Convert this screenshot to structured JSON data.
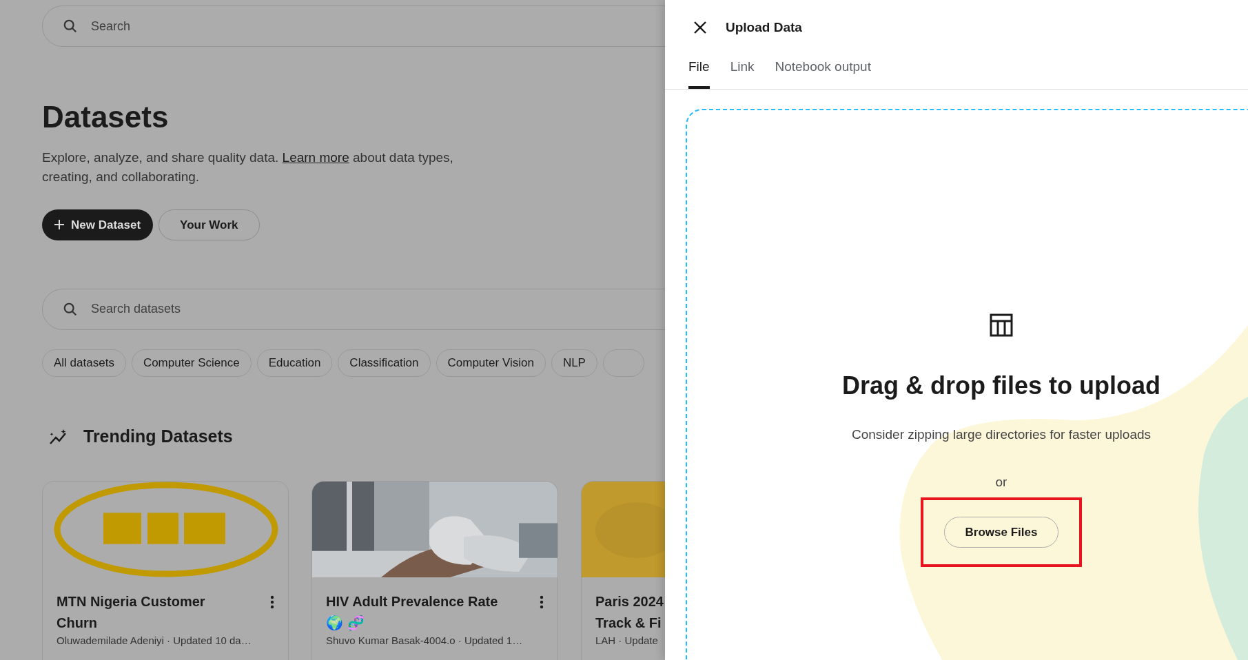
{
  "page": {
    "search": {
      "placeholder": "Search"
    },
    "title": "Datasets",
    "intro": {
      "before": "Explore, analyze, and share quality data. ",
      "link": "Learn more",
      "after": " about data types, creating, and collaborating."
    },
    "buttons": [
      {
        "label": "New Dataset",
        "kind": "primary"
      },
      {
        "label": "Your Work",
        "kind": "outline"
      }
    ],
    "dataset_search": {
      "placeholder": "Search datasets"
    },
    "filters": [
      {
        "label": "All datasets"
      },
      {
        "label": "Computer Science"
      },
      {
        "label": "Education"
      },
      {
        "label": "Classification"
      },
      {
        "label": "Computer Vision"
      },
      {
        "label": "NLP"
      }
    ],
    "section_title": "Trending Datasets",
    "cards": [
      {
        "title": "MTN Nigeria Customer Churn",
        "meta": "Oluwademilade Adeniyi · Updated 10 da…",
        "menu": true
      },
      {
        "title": "HIV Adult Prevalence Rate 🌍 🧬",
        "meta": "Shuvo Kumar Basak-4004.o · Updated 1…",
        "menu": true
      },
      {
        "title": "Paris 2024\nTrack & Fi",
        "meta": "LAH · Update"
      }
    ]
  },
  "dialog": {
    "title": "Upload Data",
    "tabs": [
      {
        "label": "File",
        "selected": true
      },
      {
        "label": "Link",
        "selected": false
      },
      {
        "label": "Notebook output",
        "selected": false
      }
    ],
    "dropzone": {
      "heading": "Drag & drop files to upload",
      "hint": "Consider zipping large directories for faster uploads",
      "or": "or",
      "button": "Browse Files",
      "highlighted": true
    }
  }
}
